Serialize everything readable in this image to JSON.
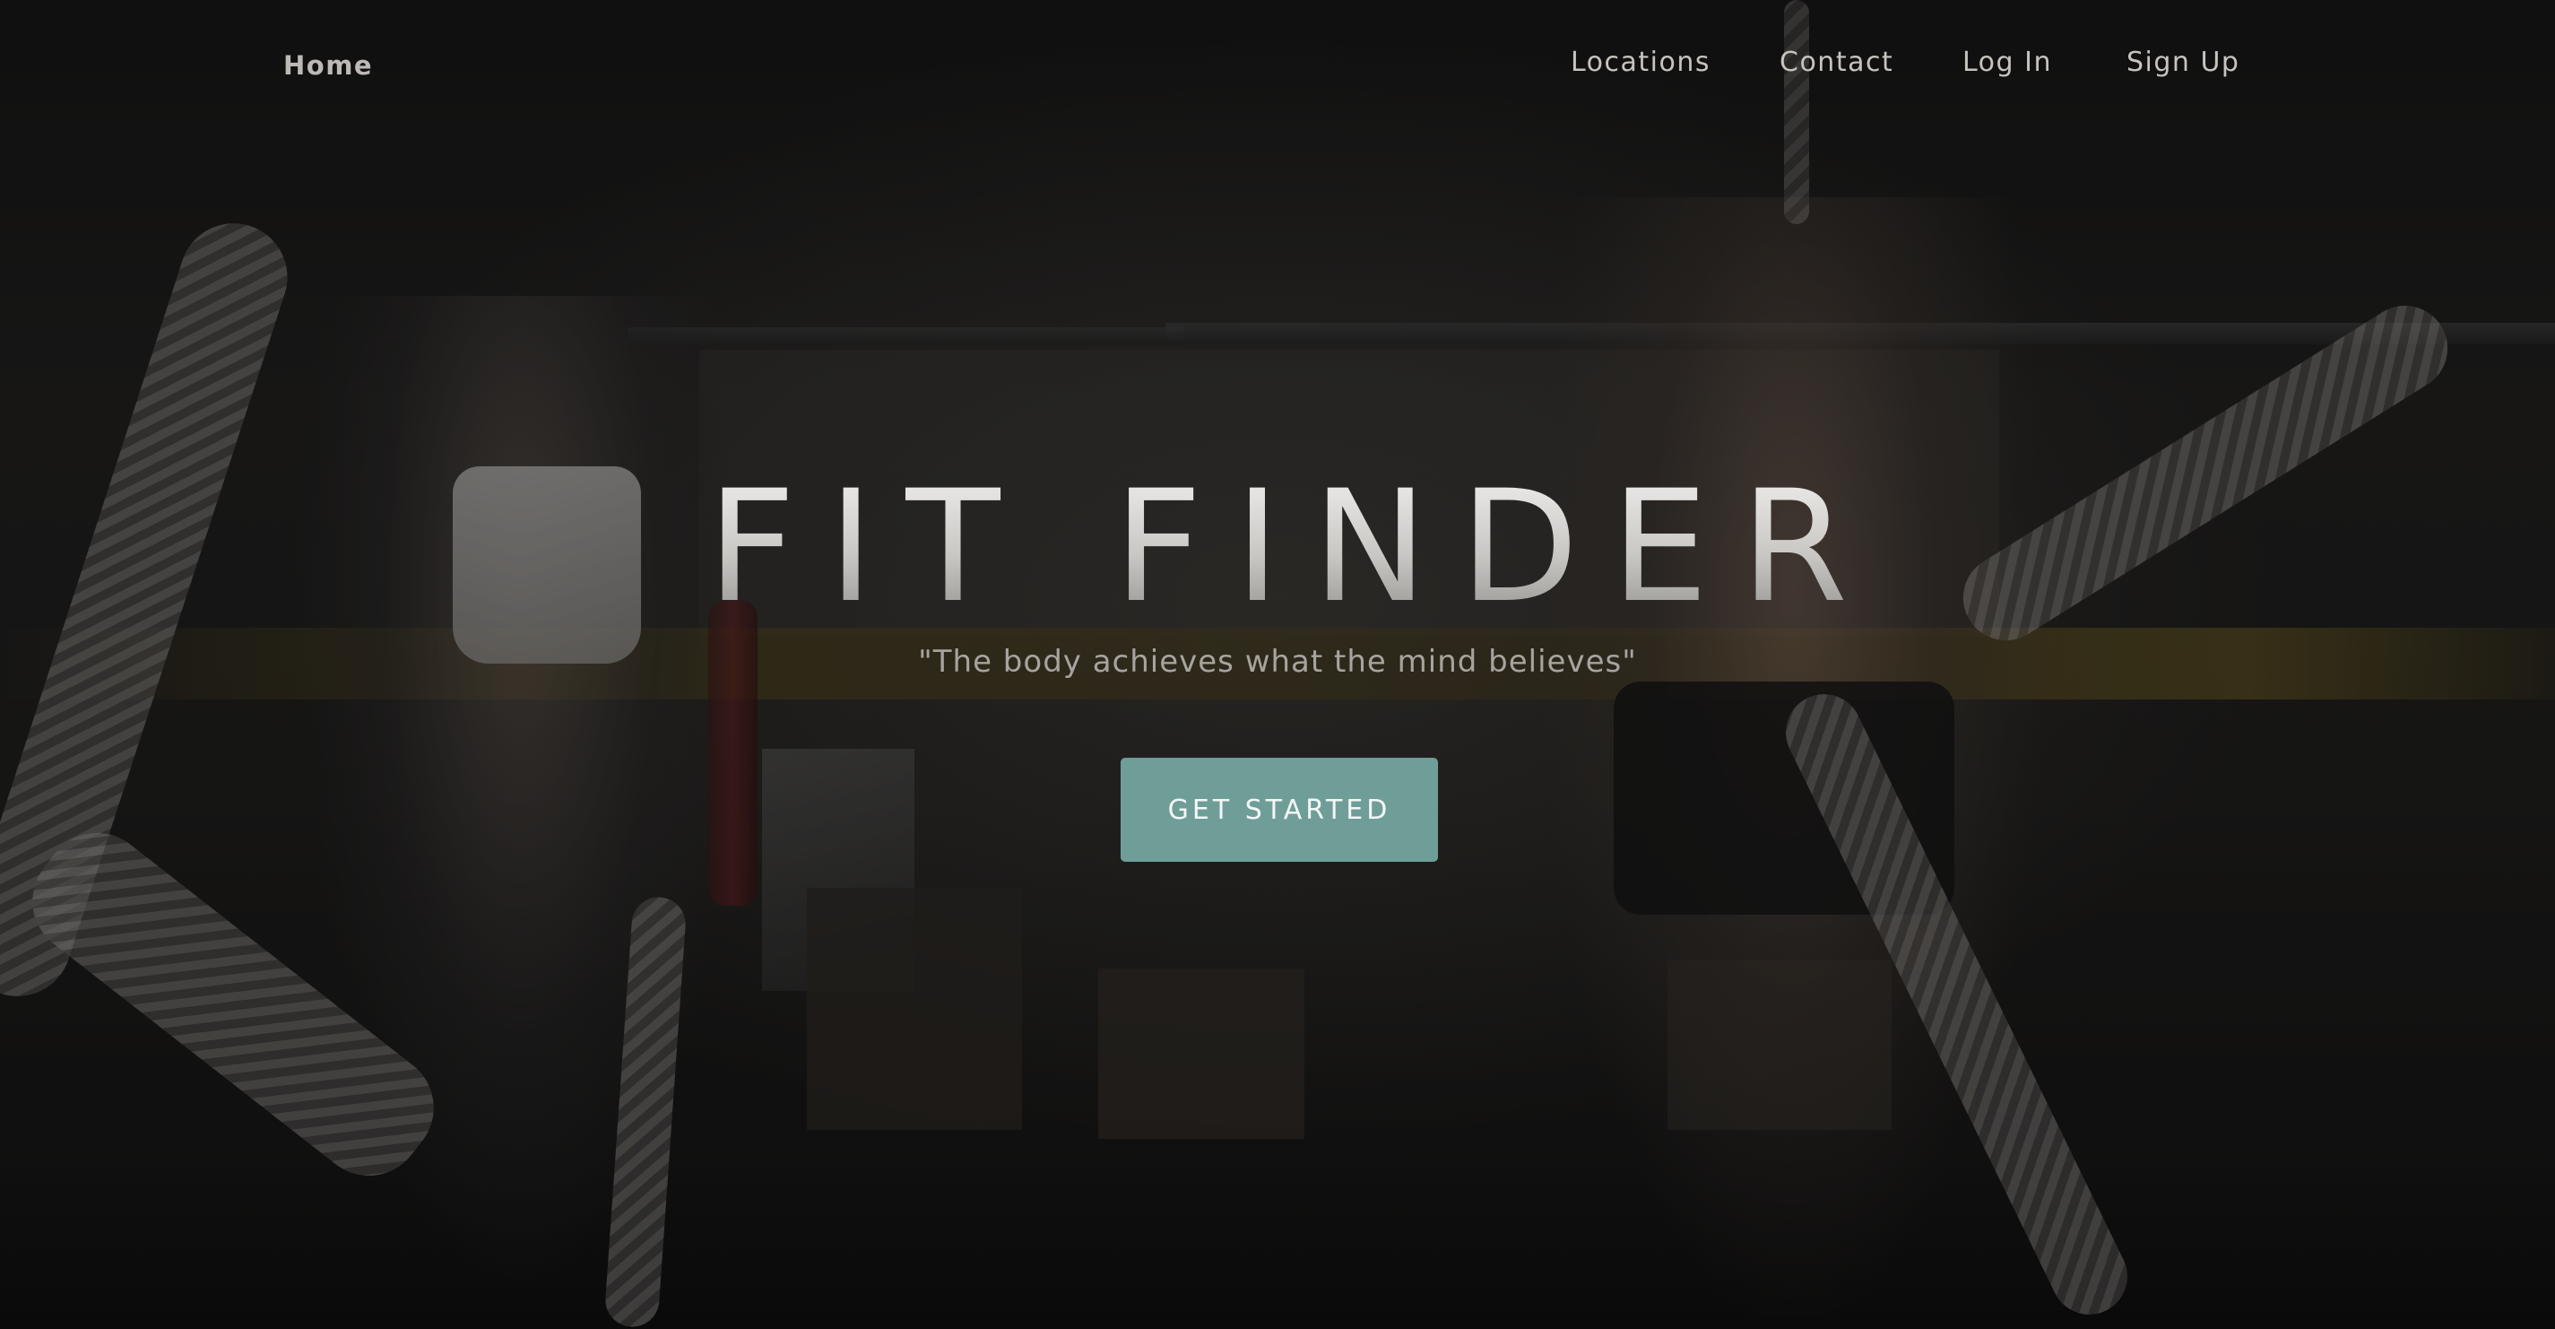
{
  "nav": {
    "home_label": "Home",
    "locations_label": "Locations",
    "contact_label": "Contact",
    "login_label": "Log In",
    "signup_label": "Sign Up"
  },
  "hero": {
    "title": "FIT FINDER",
    "tagline": "\"The body achieves what the mind believes\"",
    "cta_label": "GET STARTED"
  },
  "colors": {
    "cta_background": "#6f9e99",
    "page_background": "#0d0d0d",
    "nav_text": "#c7c3be"
  }
}
